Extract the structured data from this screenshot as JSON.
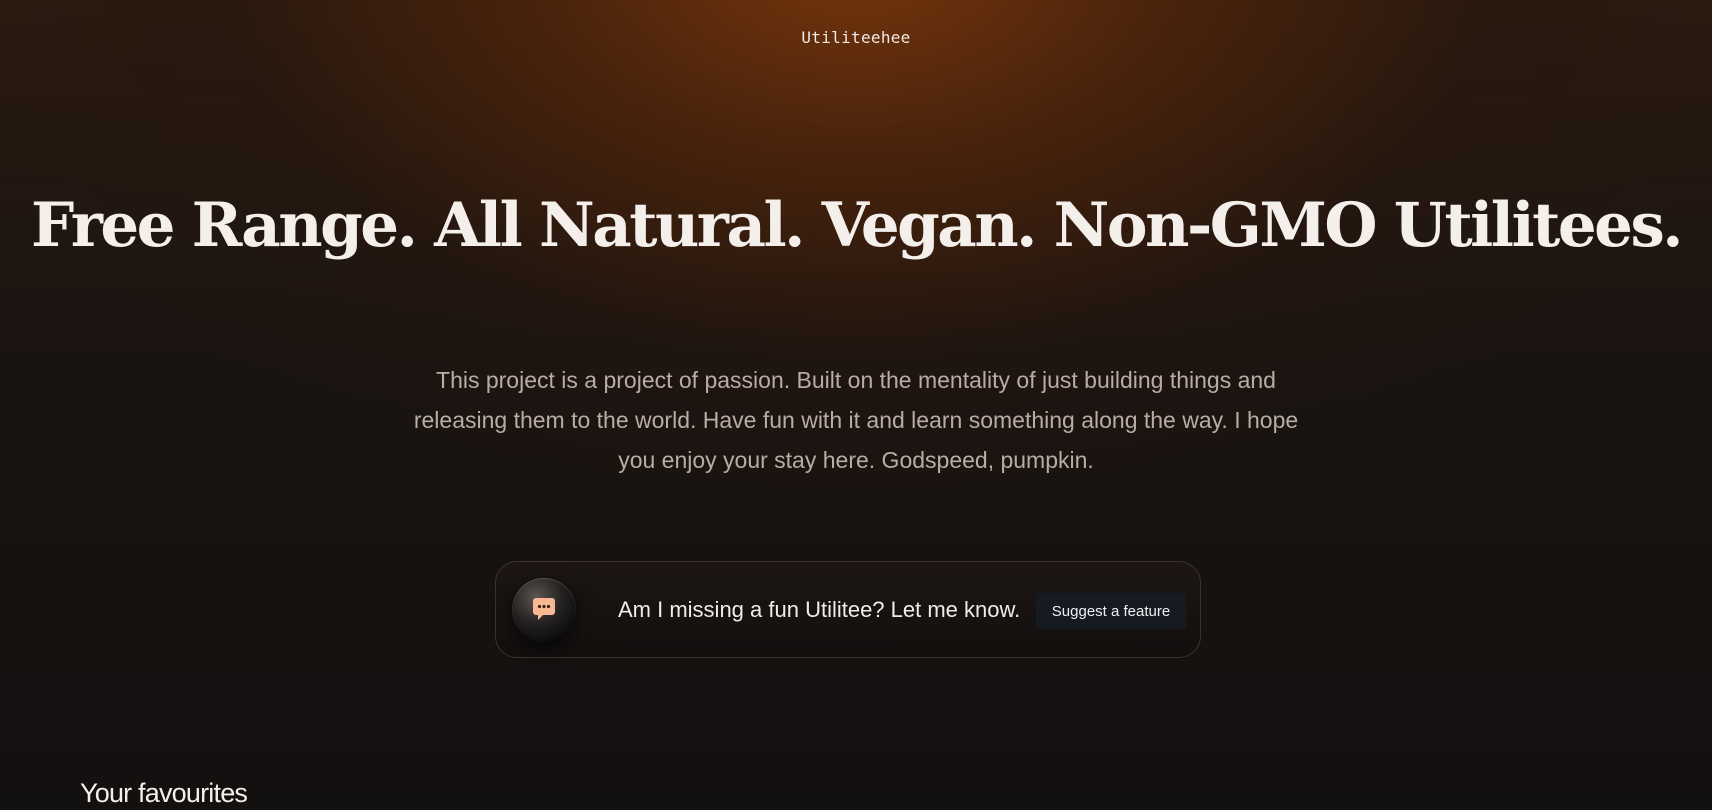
{
  "brand": {
    "name": "Utiliteehee"
  },
  "hero": {
    "headline": "Free Range. All Natural. Vegan. Non-GMO Utilitees.",
    "description": "This project is a project of passion. Built on the mentality of just building things and releasing them to the world. Have fun with it and learn something along the way. I hope you enjoy your stay here. Godspeed, pumpkin."
  },
  "cta": {
    "icon": "chat-bubble-icon",
    "text": "Am I missing a fun Utilitee? Let me know.",
    "button_label": "Suggest a feature"
  },
  "favourites": {
    "title": "Your favourites"
  },
  "colors": {
    "accent_orange": "#7a370c",
    "background": "#120f0e",
    "icon_peach": "#f7b893",
    "button_bg": "#161a21"
  }
}
